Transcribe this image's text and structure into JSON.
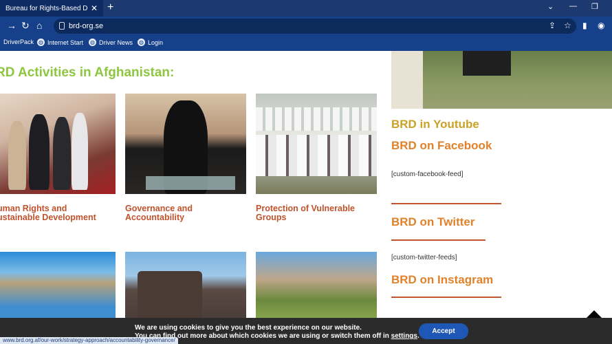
{
  "browser": {
    "tab_title": "Bureau for Rights-Based Develo",
    "url": "brd-org.se",
    "bookmarks": [
      "DriverPack",
      "Internet Start",
      "Driver News",
      "Login"
    ]
  },
  "page": {
    "heading": "RD Activities in Afghanistan:",
    "cards_row1": [
      {
        "caption_line1": "uman Rights and",
        "caption_line2": "ustainable Development"
      },
      {
        "caption_line1": "Governance and",
        "caption_line2": "Accountability"
      },
      {
        "caption_line1": "Protection of Vulnerable",
        "caption_line2": "Groups"
      }
    ],
    "sidebar": {
      "youtube": "BRD in Youtube",
      "facebook": "BRD on Facebook",
      "facebook_feed": "[custom-facebook-feed]",
      "twitter": "BRD on Twitter",
      "twitter_feed": "[custom-twitter-feeds]",
      "instagram": "BRD on Instagram"
    }
  },
  "cookie": {
    "line1": "We are using cookies to give you the best experience on our website.",
    "line2_prefix": "You can find out more about which cookies we are using or switch them off in",
    "settings_link": "settings",
    "line2_suffix": ".",
    "accept": "Accept"
  },
  "status_url": "www.brd.org.af/our-work/strategy-approach/accountability-governance/"
}
